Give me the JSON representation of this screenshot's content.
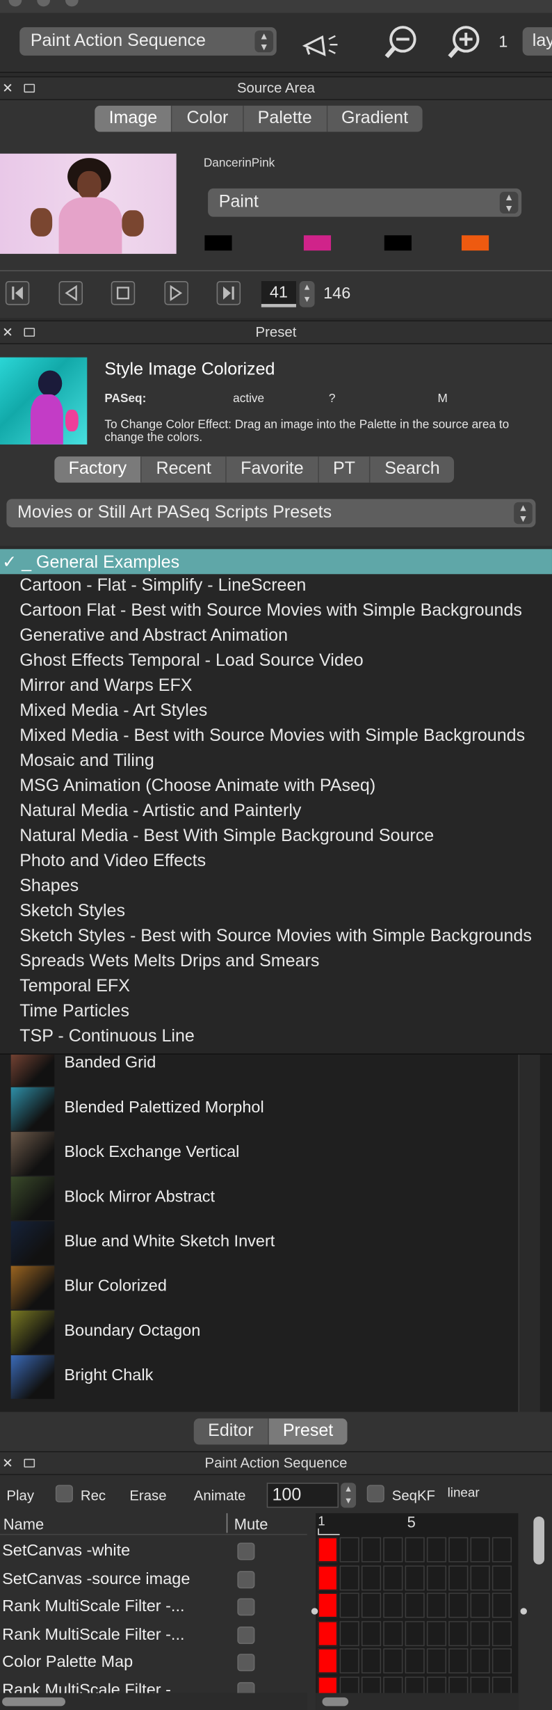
{
  "toolbar": {
    "sequence_select": "Paint Action Sequence",
    "zoom_value": "1",
    "layer_label": "lay"
  },
  "source_area": {
    "title": "Source Area",
    "tabs": [
      "Image",
      "Color",
      "Palette",
      "Gradient"
    ],
    "active_tab": "Image",
    "image_name": "DancerinPink",
    "mode_select": "Paint",
    "swatch_colors": [
      "#000000",
      "#d0238a",
      "#000000",
      "#ee5a10"
    ]
  },
  "transport": {
    "frame": "41",
    "total": "146"
  },
  "preset": {
    "title": "Preset",
    "name": "Style Image Colorized",
    "paseq_label": "PASeq:",
    "paseq_status": "active",
    "paseq_q": "?",
    "paseq_m": "M",
    "description": "To Change Color Effect: Drag an image into the Palette in the source area to change the colors.",
    "tabs": [
      "Factory",
      "Recent",
      "Favorite",
      "PT",
      "Search"
    ],
    "active_tab": "Factory",
    "category_select": "Movies or Still Art PASeq Scripts Presets"
  },
  "dropdown": {
    "selected": "✓ _ General Examples",
    "items": [
      "Cartoon - Flat - Simplify - LineScreen",
      "Cartoon Flat - Best with Source Movies with Simple Backgrounds",
      "Generative and Abstract Animation",
      "Ghost Effects Temporal - Load Source Video",
      "Mirror and Warps EFX",
      "Mixed Media - Art Styles",
      "Mixed Media - Best with Source Movies with Simple Backgrounds",
      "Mosaic and Tiling",
      "MSG Animation (Choose Animate with PAseq)",
      "Natural Media - Artistic and Painterly",
      "Natural Media - Best With Simple Background Source",
      "Photo and Video Effects",
      "Shapes",
      "Sketch Styles",
      "Sketch Styles - Best with Source Movies with Simple Backgrounds",
      "Spreads Wets Melts Drips and Smears",
      "Temporal EFX",
      "Time Particles",
      "TSP - Continuous Line"
    ]
  },
  "preset_list": [
    "Banded Grid",
    "Blended Palettized Morphol",
    "Block Exchange Vertical",
    "Block Mirror Abstract",
    "Blue and White Sketch Invert",
    "Blur Colorized",
    "Boundary Octagon",
    "Bright Chalk"
  ],
  "bottom_tabs": {
    "items": [
      "Editor",
      "Preset"
    ],
    "active": "Preset"
  },
  "pas": {
    "title": "Paint Action Sequence",
    "play": "Play",
    "rec": "Rec",
    "erase": "Erase",
    "animate": "Animate",
    "animate_value": "100",
    "seqkf": "SeqKF",
    "interp": "linear",
    "col_name": "Name",
    "col_mute": "Mute",
    "timeline_marks": [
      "1",
      "5"
    ],
    "steps": [
      "SetCanvas -white",
      "SetCanvas -source image",
      "Rank MultiScale Filter -...",
      "Rank MultiScale Filter -...",
      "Color Palette Map",
      "Rank MultiScale Filter -..."
    ]
  },
  "colors": {
    "dropdown_highlight": "#5fa7a8",
    "keyframe_red": "#ff0000"
  }
}
